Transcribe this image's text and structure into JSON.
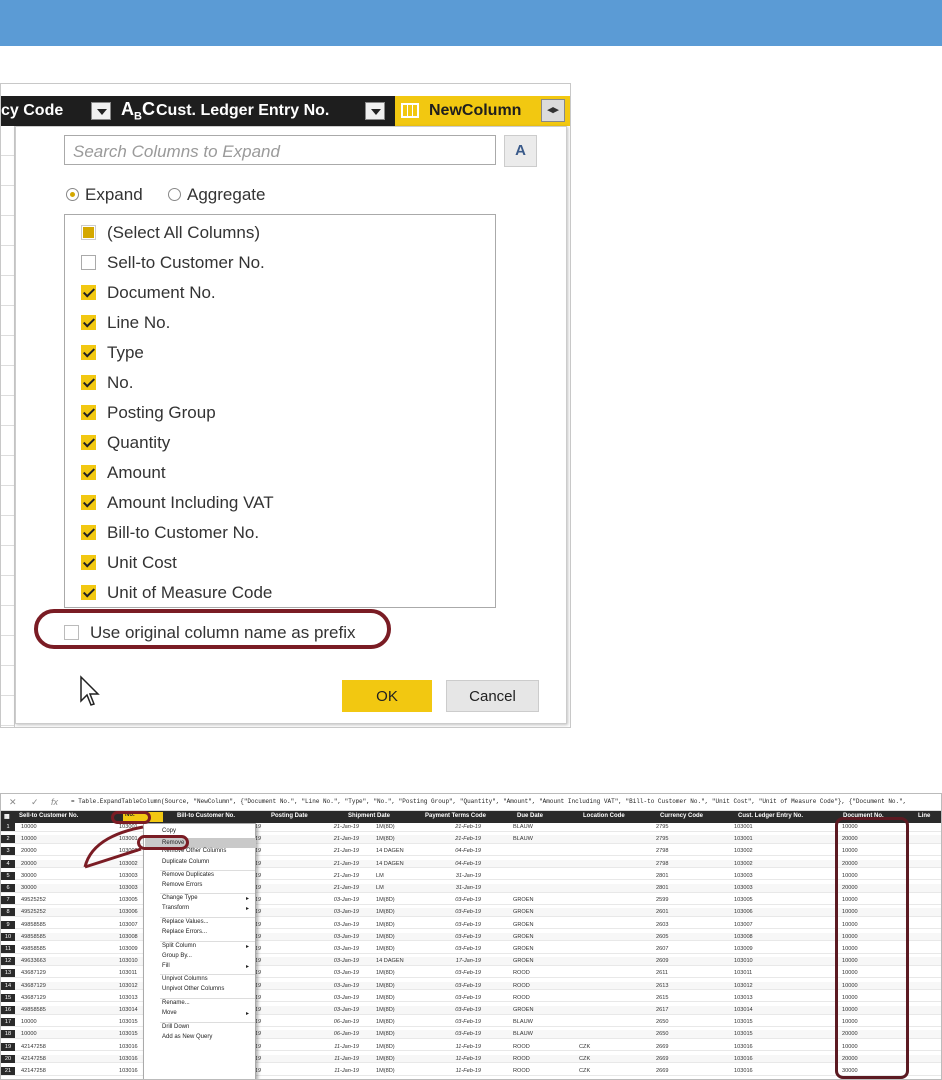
{
  "header_bar": {
    "color": "#5b9bd5"
  },
  "expand_dialog": {
    "column_header": {
      "col1_label": "cy Code",
      "col2_type_icon": "abc-text-type-icon",
      "col2_label": "Cust. Ledger Entry No.",
      "col3_label": "NewColumn",
      "expand_icon": "expand-columns-icon"
    },
    "search_placeholder": "Search Columns to Expand",
    "sort_label": "A Z",
    "mode": {
      "expand_label": "Expand",
      "aggregate_label": "Aggregate",
      "selected": "Expand"
    },
    "columns": [
      {
        "label": "(Select All Columns)",
        "state": "partial"
      },
      {
        "label": "Sell-to Customer No.",
        "state": "unchecked"
      },
      {
        "label": "Document No.",
        "state": "checked"
      },
      {
        "label": "Line No.",
        "state": "checked"
      },
      {
        "label": "Type",
        "state": "checked"
      },
      {
        "label": "No.",
        "state": "checked"
      },
      {
        "label": "Posting Group",
        "state": "checked"
      },
      {
        "label": "Quantity",
        "state": "checked"
      },
      {
        "label": "Amount",
        "state": "checked"
      },
      {
        "label": "Amount Including VAT",
        "state": "checked"
      },
      {
        "label": "Bill-to Customer No.",
        "state": "checked"
      },
      {
        "label": "Unit Cost",
        "state": "checked"
      },
      {
        "label": "Unit of Measure Code",
        "state": "checked"
      }
    ],
    "prefix_label": "Use original column name as prefix",
    "prefix_checked": false,
    "ok_label": "OK",
    "cancel_label": "Cancel",
    "accent_color": "#f2c811",
    "highlight_color": "#7a1c24"
  },
  "query_editor": {
    "formula_prefix": "fx",
    "formula": "= Table.ExpandTableColumn(Source, \"NewColumn\", {\"Document No.\", \"Line No.\", \"Type\", \"No.\", \"Posting Group\", \"Quantity\", \"Amount\", \"Amount Including VAT\", \"Bill-to Customer No.\", \"Unit Cost\", \"Unit of Measure Code\"}, {\"Document No.\",",
    "columns": [
      "Sell-to Customer No.",
      "No.",
      "Bill-to Customer No.",
      "Posting Date",
      "Shipment Date",
      "Payment Terms Code",
      "Due Date",
      "Location Code",
      "Currency Code",
      "Cust. Ledger Entry No.",
      "Document No.",
      "Line"
    ],
    "rows": [
      [
        "1",
        "10000",
        "103001",
        "21-Jan-19",
        "21-Jan-19",
        "1M(8D)",
        "21-Feb-19",
        "BLAUW",
        "",
        "2795",
        "103001",
        "10000"
      ],
      [
        "2",
        "10000",
        "103001",
        "21-Jan-19",
        "21-Jan-19",
        "1M(8D)",
        "21-Feb-19",
        "BLAUW",
        "",
        "2795",
        "103001",
        "20000"
      ],
      [
        "3",
        "20000",
        "103002",
        "21-Jan-19",
        "21-Jan-19",
        "14 DAGEN",
        "04-Feb-19",
        "",
        "",
        "2798",
        "103002",
        "10000"
      ],
      [
        "4",
        "20000",
        "103002",
        "21-Jan-19",
        "21-Jan-19",
        "14 DAGEN",
        "04-Feb-19",
        "",
        "",
        "2798",
        "103002",
        "20000"
      ],
      [
        "5",
        "30000",
        "103003",
        "21-Jan-19",
        "21-Jan-19",
        "LM",
        "31-Jan-19",
        "",
        "",
        "2801",
        "103003",
        "10000"
      ],
      [
        "6",
        "30000",
        "103003",
        "21-Jan-19",
        "21-Jan-19",
        "LM",
        "31-Jan-19",
        "",
        "",
        "2801",
        "103003",
        "20000"
      ],
      [
        "7",
        "49525252",
        "103005",
        "03-Jan-19",
        "03-Jan-19",
        "1M(8D)",
        "03-Feb-19",
        "GROEN",
        "",
        "2599",
        "103005",
        "10000"
      ],
      [
        "8",
        "49525252",
        "103006",
        "03-Jan-19",
        "03-Jan-19",
        "1M(8D)",
        "03-Feb-19",
        "GROEN",
        "",
        "2601",
        "103006",
        "10000"
      ],
      [
        "9",
        "49858585",
        "103007",
        "03-Jan-19",
        "03-Jan-19",
        "1M(8D)",
        "03-Feb-19",
        "GROEN",
        "",
        "2603",
        "103007",
        "10000"
      ],
      [
        "10",
        "49858585",
        "103008",
        "03-Jan-19",
        "03-Jan-19",
        "1M(8D)",
        "03-Feb-19",
        "GROEN",
        "",
        "2605",
        "103008",
        "10000"
      ],
      [
        "11",
        "49858585",
        "103009",
        "03-Jan-19",
        "03-Jan-19",
        "1M(8D)",
        "03-Feb-19",
        "GROEN",
        "",
        "2607",
        "103009",
        "10000"
      ],
      [
        "12",
        "49633663",
        "103010",
        "03-Jan-19",
        "03-Jan-19",
        "14 DAGEN",
        "17-Jan-19",
        "GROEN",
        "",
        "2609",
        "103010",
        "10000"
      ],
      [
        "13",
        "43687129",
        "103011",
        "03-Jan-19",
        "03-Jan-19",
        "1M(8D)",
        "03-Feb-19",
        "ROOD",
        "",
        "2611",
        "103011",
        "10000"
      ],
      [
        "14",
        "43687129",
        "103012",
        "03-Jan-19",
        "03-Jan-19",
        "1M(8D)",
        "03-Feb-19",
        "ROOD",
        "",
        "2613",
        "103012",
        "10000"
      ],
      [
        "15",
        "43687129",
        "103013",
        "03-Jan-19",
        "03-Jan-19",
        "1M(8D)",
        "03-Feb-19",
        "ROOD",
        "",
        "2615",
        "103013",
        "10000"
      ],
      [
        "16",
        "49858585",
        "103014",
        "03-Jan-19",
        "03-Jan-19",
        "1M(8D)",
        "03-Feb-19",
        "GROEN",
        "",
        "2617",
        "103014",
        "10000"
      ],
      [
        "17",
        "10000",
        "103015",
        "06-Jan-19",
        "06-Jan-19",
        "1M(8D)",
        "03-Feb-19",
        "BLAUW",
        "",
        "2650",
        "103015",
        "10000"
      ],
      [
        "18",
        "10000",
        "103015",
        "06-Jan-19",
        "06-Jan-19",
        "1M(8D)",
        "03-Feb-19",
        "BLAUW",
        "",
        "2650",
        "103015",
        "20000"
      ],
      [
        "19",
        "42147258",
        "103016",
        "12-Jan-19",
        "11-Jan-19",
        "1M(8D)",
        "11-Feb-19",
        "ROOD",
        "CZK",
        "2669",
        "103016",
        "10000"
      ],
      [
        "20",
        "42147258",
        "103016",
        "12-Jan-19",
        "11-Jan-19",
        "1M(8D)",
        "11-Feb-19",
        "ROOD",
        "CZK",
        "2669",
        "103016",
        "20000"
      ],
      [
        "21",
        "42147258",
        "103016",
        "12-Jan-19",
        "11-Jan-19",
        "1M(8D)",
        "11-Feb-19",
        "ROOD",
        "CZK",
        "2669",
        "103016",
        "30000"
      ]
    ],
    "context_menu": [
      "Copy",
      "Remove",
      "Remove Other Columns",
      "Duplicate Column",
      "Remove Duplicates",
      "Remove Errors",
      "Change Type",
      "Transform",
      "Replace Values...",
      "Replace Errors...",
      "Split Column",
      "Group By...",
      "Fill",
      "Unpivot Columns",
      "Unpivot Other Columns",
      "Rename...",
      "Move",
      "Drill Down",
      "Add as New Query"
    ],
    "selected_menu_item": "Remove"
  }
}
